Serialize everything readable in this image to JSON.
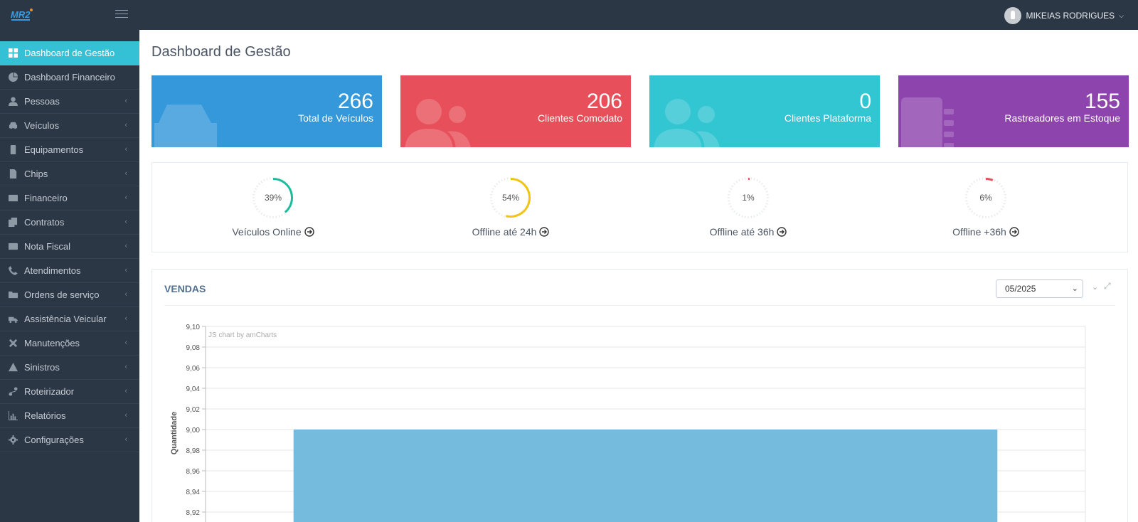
{
  "header": {
    "logo_icon": "mr2-logo-icon",
    "user_name": "MIKEIAS RODRIGUES"
  },
  "sidebar": {
    "items": [
      {
        "label": "Dashboard de Gestão",
        "icon": "dashboard-icon",
        "active": true
      },
      {
        "label": "Dashboard Financeiro",
        "icon": "pie-chart-icon"
      },
      {
        "label": "Pessoas",
        "icon": "user-icon"
      },
      {
        "label": "Veículos",
        "icon": "car-icon"
      },
      {
        "label": "Equipamentos",
        "icon": "device-icon"
      },
      {
        "label": "Chips",
        "icon": "sim-chip-icon"
      },
      {
        "label": "Financeiro",
        "icon": "credit-card-icon"
      },
      {
        "label": "Contratos",
        "icon": "document-copy-icon"
      },
      {
        "label": "Nota Fiscal",
        "icon": "invoice-icon"
      },
      {
        "label": "Atendimentos",
        "icon": "phone-icon"
      },
      {
        "label": "Ordens de serviço",
        "icon": "folder-icon"
      },
      {
        "label": "Assistência Veicular",
        "icon": "tow-truck-icon"
      },
      {
        "label": "Manutenções",
        "icon": "tools-icon"
      },
      {
        "label": "Sinistros",
        "icon": "warning-icon"
      },
      {
        "label": "Roteirizador",
        "icon": "route-icon"
      },
      {
        "label": "Relatórios",
        "icon": "bar-chart-icon"
      },
      {
        "label": "Configurações",
        "icon": "gear-icon"
      }
    ]
  },
  "main": {
    "title": "Dashboard de Gestão",
    "cards": [
      {
        "value": "266",
        "label": "Total de Veículos",
        "color": "#3498db",
        "icon": "car-icon"
      },
      {
        "value": "206",
        "label": "Clientes Comodato",
        "color": "#e7505a",
        "icon": "users-icon"
      },
      {
        "value": "0",
        "label": "Clientes Plataforma",
        "color": "#32c5d2",
        "icon": "users-icon"
      },
      {
        "value": "155",
        "label": "Rastreadores em Estoque",
        "color": "#8e44ad",
        "icon": "tracker-device-icon"
      }
    ],
    "stats": [
      {
        "percent": 39,
        "percent_label": "39%",
        "label": "Veículos Online",
        "color": "#1bbc9b"
      },
      {
        "percent": 54,
        "percent_label": "54%",
        "label": "Offline até 24h",
        "color": "#f1c40f"
      },
      {
        "percent": 1,
        "percent_label": "1%",
        "label": "Offline até 36h",
        "color": "#e7505a"
      },
      {
        "percent": 6,
        "percent_label": "6%",
        "label": "Offline +36h",
        "color": "#e7505a"
      }
    ],
    "sales_panel": {
      "title": "VENDAS",
      "month_selected": "05/2025"
    }
  },
  "chart_data": {
    "type": "bar",
    "title": "",
    "watermark": "JS chart by amCharts",
    "ylabel": "Quantidade",
    "ylim": [
      8.92,
      9.1
    ],
    "yticks": [
      "9,10",
      "9,08",
      "9,06",
      "9,04",
      "9,02",
      "9,00",
      "8,98",
      "8,96",
      "8,94",
      "8,92"
    ],
    "values": [
      9.0
    ],
    "color": "#74bbde"
  }
}
